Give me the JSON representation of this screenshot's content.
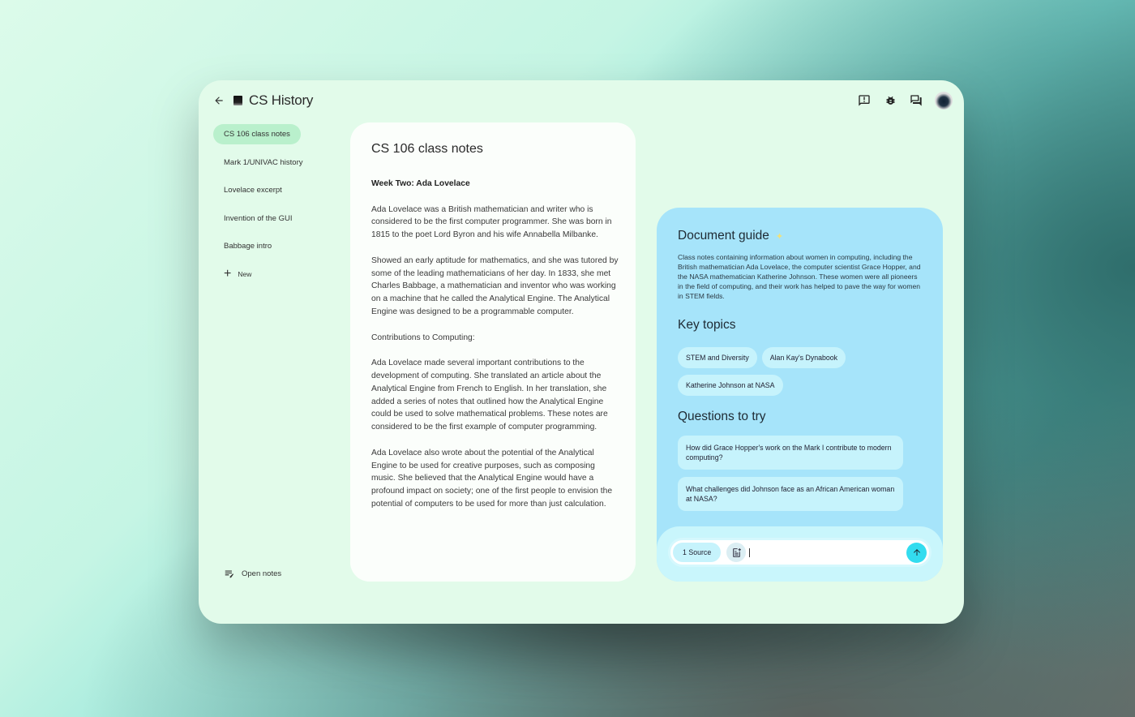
{
  "app": {
    "title": "CS History",
    "back_label": "Back",
    "top_actions": [
      {
        "name": "feedback-icon",
        "label": "Feedback"
      },
      {
        "name": "bug-icon",
        "label": "Report bug"
      },
      {
        "name": "chat-icon",
        "label": "Chat"
      },
      {
        "name": "avatar",
        "label": "Account"
      }
    ]
  },
  "sidebar": {
    "items": [
      {
        "label": "CS 106 class notes",
        "active": true
      },
      {
        "label": "Mark 1/UNIVAC history",
        "active": false
      },
      {
        "label": "Lovelace excerpt",
        "active": false
      },
      {
        "label": "Invention of the GUI",
        "active": false
      },
      {
        "label": "Babbage intro",
        "active": false
      }
    ],
    "new_label": "New",
    "open_notes_label": "Open notes"
  },
  "document": {
    "title": "CS 106 class notes",
    "heading": "Week Two: Ada Lovelace",
    "paragraphs": [
      "Ada Lovelace was a British mathematician and writer who is considered to be the first computer programmer. She was born in 1815 to the poet Lord Byron and his wife Annabella Milbanke.",
      "Showed an early aptitude for mathematics, and she was tutored by some of the leading mathematicians of her day. In 1833, she met Charles Babbage, a mathematician and inventor who was working on a machine that he called the Analytical Engine. The Analytical Engine was designed to be a programmable computer.",
      "Contributions to Computing:",
      "Ada Lovelace made several important contributions to the development of computing. She translated an article about the Analytical Engine from French to English. In her translation, she added a series of notes that outlined how the Analytical Engine could be used to solve mathematical problems. These notes are considered to be the first example of computer programming.",
      "Ada Lovelace also wrote about the potential of the Analytical Engine to be used for creative purposes, such as composing music. She believed that the Analytical Engine would have a profound impact on society; one of the first people to envision the potential of computers to be used for more than just calculation."
    ]
  },
  "guide": {
    "title": "Document guide",
    "sparkle_icon": "sparkle-icon",
    "summary": "Class notes containing information about women in computing, including the British mathematician Ada Lovelace, the computer scientist Grace Hopper, and the NASA mathematician Katherine Johnson. These women were all pioneers in the field of computing, and their work has helped to pave the way for women in STEM fields.",
    "key_topics_title": "Key topics",
    "key_topics": [
      "STEM and Diversity",
      "Alan Kay's Dynabook",
      "Katherine Johnson at NASA"
    ],
    "questions_title": "Questions to try",
    "questions": [
      "How did Grace Hopper's work on the Mark I contribute to modern computing?",
      "What challenges did Johnson face as an African American woman at NASA?"
    ]
  },
  "composer": {
    "source_label": "1 Source",
    "input_value": "",
    "send_label": "Send"
  },
  "colors": {
    "window_bg": "#e2fbea",
    "active_item": "#b9f0cc",
    "guide_bg": "#a6e4fa",
    "chip_bg": "#c6f3fc",
    "send_accent": "#33dcef"
  }
}
